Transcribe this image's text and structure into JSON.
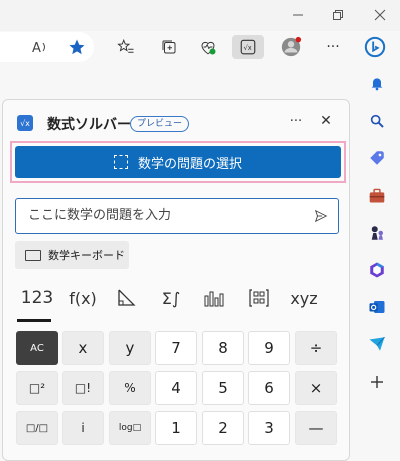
{
  "toolbar": {
    "read_aloud_icon": "read-aloud-icon",
    "favorite_icon": "star-icon",
    "favorites_icon": "favorites-list-icon",
    "collections_icon": "collections-icon",
    "health_icon": "browser-essentials-icon",
    "math_icon": "math-solver-icon",
    "profile_icon": "profile-icon",
    "more_label": "···",
    "copilot_icon": "bing-icon"
  },
  "sidebar": {
    "items": [
      {
        "icon": "bell-icon"
      },
      {
        "icon": "search-icon"
      },
      {
        "icon": "tag-icon"
      },
      {
        "icon": "toolbox-icon"
      },
      {
        "icon": "chess-icon"
      },
      {
        "icon": "office-icon"
      },
      {
        "icon": "outlook-icon"
      },
      {
        "icon": "send-icon"
      },
      {
        "icon": "plus-icon"
      }
    ]
  },
  "panel": {
    "title": "数式ソルバー",
    "badge": "プレビュー",
    "more_label": "···",
    "close_label": "✕",
    "select_button_label": "数学の問題の選択",
    "input_placeholder": "ここに数学の問題を入力",
    "keyboard_button_label": "数学キーボード",
    "tabs": [
      "123",
      "f(x)",
      "◺",
      "Σ∫",
      "ılıl",
      "[⁞⁞]",
      "xyz"
    ]
  },
  "keypad": {
    "rows": [
      [
        "AC",
        "x",
        "y",
        "7",
        "8",
        "9",
        "÷"
      ],
      [
        "□²",
        "□!",
        "%",
        "4",
        "5",
        "6",
        "×"
      ],
      [
        "□/□",
        "i",
        "log□",
        "1",
        "2",
        "3",
        "—"
      ]
    ]
  },
  "colors": {
    "accent": "#0f6cbd",
    "highlight": "#f0a9c4",
    "keypad_dark": "#3f3f3f"
  }
}
